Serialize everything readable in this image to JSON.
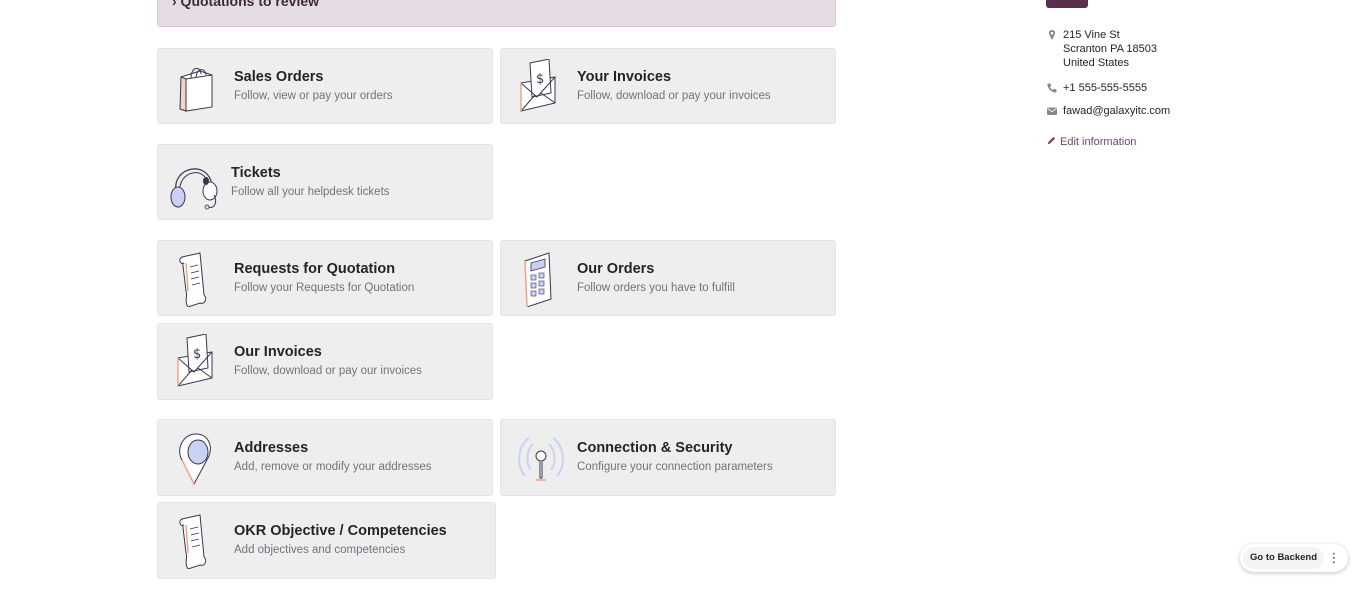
{
  "alert": {
    "text": "› Quotations to review"
  },
  "cards": [
    {
      "title": "Sales Orders",
      "desc": "Follow, view or pay your orders",
      "icon": "shopping-bag-icon"
    },
    {
      "title": "Your Invoices",
      "desc": "Follow, download or pay your invoices",
      "icon": "invoice-envelope-icon"
    },
    {
      "title": "Tickets",
      "desc": "Follow all your helpdesk tickets",
      "icon": "headset-icon"
    },
    {
      "title": "Requests for Quotation",
      "desc": "Follow your Requests for Quotation",
      "icon": "scroll-document-icon"
    },
    {
      "title": "Our Orders",
      "desc": "Follow orders you have to fulfill",
      "icon": "calculator-icon"
    },
    {
      "title": "Our Invoices",
      "desc": "Follow, download or pay our invoices",
      "icon": "invoice-envelope-icon"
    },
    {
      "title": "Addresses",
      "desc": "Add, remove or modify your addresses",
      "icon": "map-pin-icon"
    },
    {
      "title": "Connection & Security",
      "desc": "Configure your connection parameters",
      "icon": "antenna-signal-icon"
    },
    {
      "title": "OKR Objective / Competencies",
      "desc": "Add objectives and competencies",
      "icon": "scroll-document-icon"
    }
  ],
  "contact": {
    "address_lines": [
      "215 Vine St",
      "Scranton PA 18503",
      "United States"
    ],
    "phone": "+1 555-555-5555",
    "email": "fawad@galaxyitc.com",
    "edit_label": "Edit information"
  },
  "floating": {
    "backend_label": "Go to Backend",
    "menu_glyph": "⋮"
  },
  "colors": {
    "accent": "#71466a",
    "card_bg": "#eeeeee",
    "alert_bg": "#e6dce3"
  }
}
